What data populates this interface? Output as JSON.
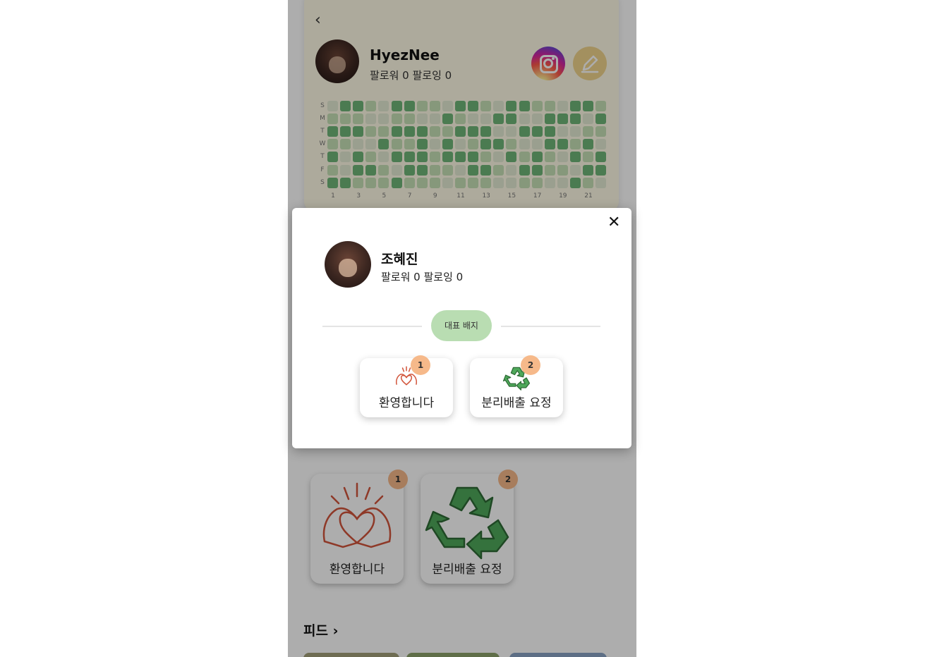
{
  "profile": {
    "back_icon": "chevron-left-icon",
    "username": "HyezNee",
    "follow_text": "팔로워 0 팔로잉 0",
    "instagram_icon": "instagram-icon",
    "edit_icon": "pencil-icon"
  },
  "heatmap": {
    "day_labels": [
      "S",
      "M",
      "T",
      "W",
      "T",
      "F",
      "S"
    ],
    "column_labels": [
      "1",
      "3",
      "5",
      "7",
      "9",
      "11",
      "13",
      "15",
      "17",
      "19",
      "21"
    ],
    "colors": {
      "level0": "#e3ead3",
      "level1": "#c6e0b6",
      "level2": "#6fb678"
    }
  },
  "badges": {
    "items": [
      {
        "label": "환영합니다",
        "count": "1",
        "icon": "heart-hands-icon"
      },
      {
        "label": "분리배출 요정",
        "count": "2",
        "icon": "recycle-icon"
      }
    ]
  },
  "feed": {
    "title": "피드 ›"
  },
  "modal": {
    "username": "조혜진",
    "follow_text": "팔로워 0 팔로잉 0",
    "section_pill": "대표 배지",
    "close_icon": "close-icon",
    "badges": [
      {
        "label": "환영합니다",
        "count": "1",
        "icon": "heart-hands-icon"
      },
      {
        "label": "분리배출 요정",
        "count": "2",
        "icon": "recycle-icon"
      }
    ]
  }
}
